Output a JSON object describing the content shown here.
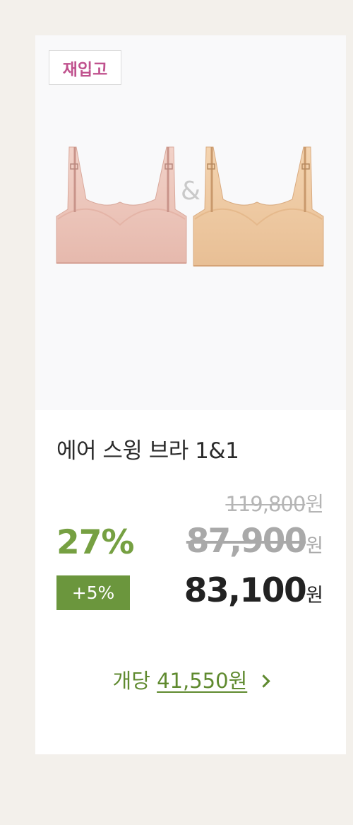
{
  "badge": "재입고",
  "product": {
    "title": "에어 스윙 브라 1&1",
    "image_ampersand": "&",
    "image_alt": "bra-pair-pink-beige"
  },
  "price": {
    "original": "119,800",
    "sale": "87,900",
    "final": "83,100",
    "currency": "원",
    "discount_percent": "27%",
    "extra_discount": "+5%"
  },
  "per_unit": {
    "prefix": "개당",
    "amount": "41,550원"
  },
  "colors": {
    "background": "#f3f0eb",
    "image_area": "#f9f9fa",
    "badge_text": "#c0528e",
    "accent_green": "#76a042",
    "extra_badge_bg": "#6b963d",
    "per_unit_text": "#5f8a2f",
    "pink_product": "#edc6bc",
    "beige_product": "#efcaa3"
  }
}
